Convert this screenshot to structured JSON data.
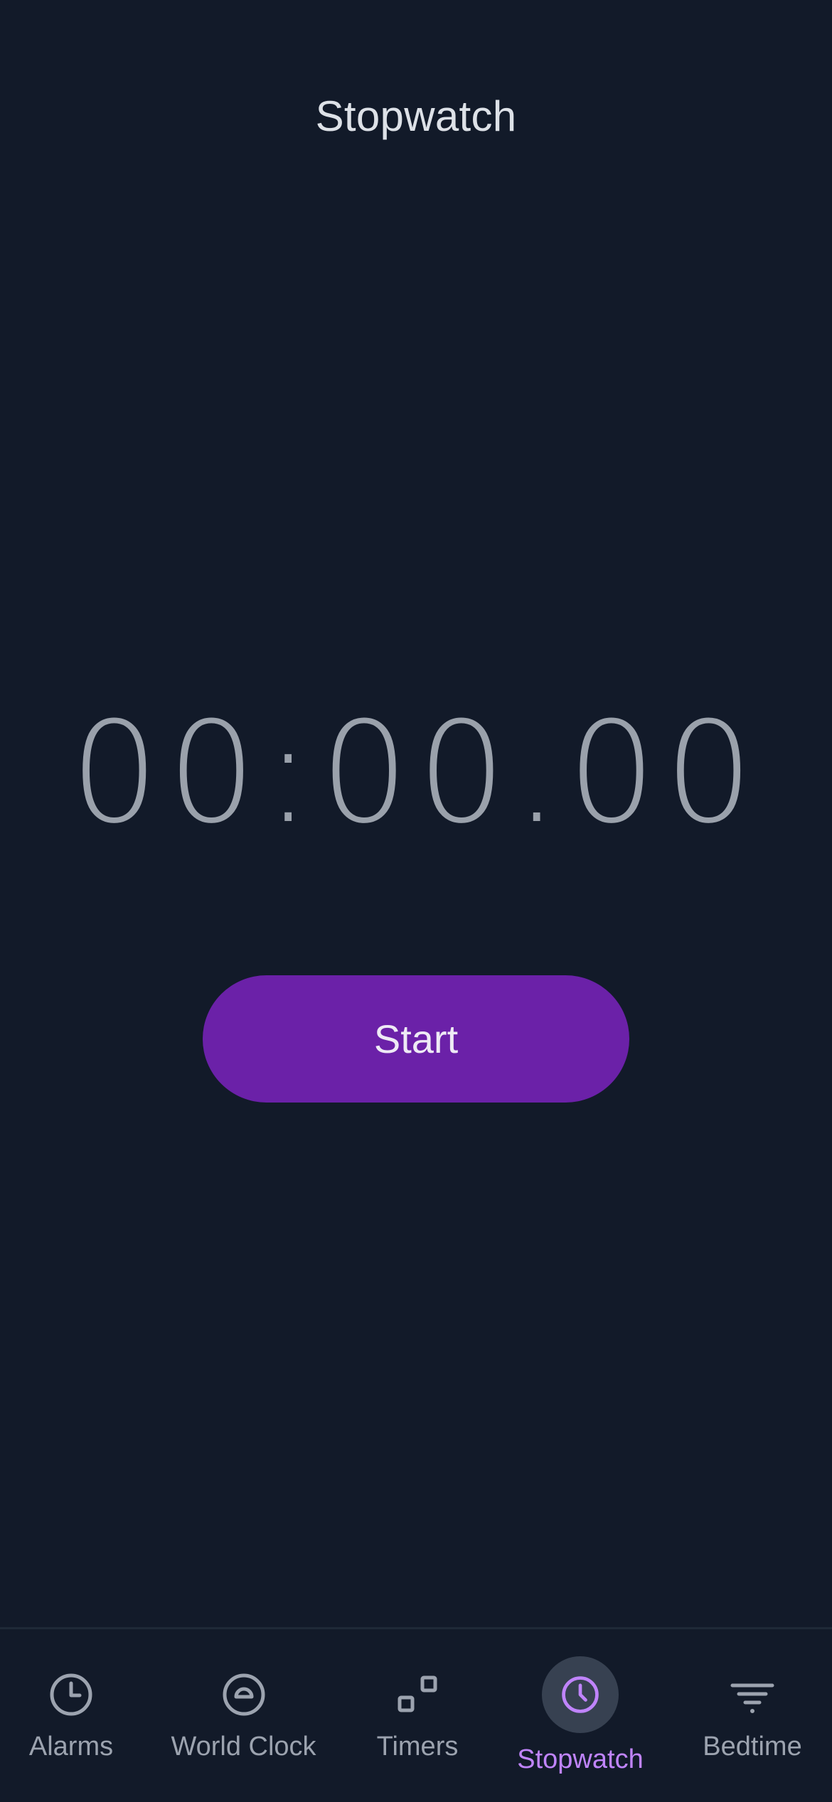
{
  "header": {
    "title": "Stopwatch"
  },
  "stopwatch": {
    "display": "00:00.00",
    "start_label": "Start"
  },
  "tabs": [
    {
      "label": "Alarms",
      "icon": "alarm-clock-icon",
      "active": false
    },
    {
      "label": "World Clock",
      "icon": "globe-icon",
      "active": false
    },
    {
      "label": "Timers",
      "icon": "timers-icon",
      "active": false
    },
    {
      "label": "Stopwatch",
      "icon": "stopwatch-icon",
      "active": true
    },
    {
      "label": "Bedtime",
      "icon": "bedtime-icon",
      "active": false
    }
  ],
  "colors": {
    "background": "#121a29",
    "accent": "#6b21a8",
    "active_tab": "#c084fc",
    "inactive_tab": "#9ca3af",
    "time_text": "#9aa1ab"
  }
}
